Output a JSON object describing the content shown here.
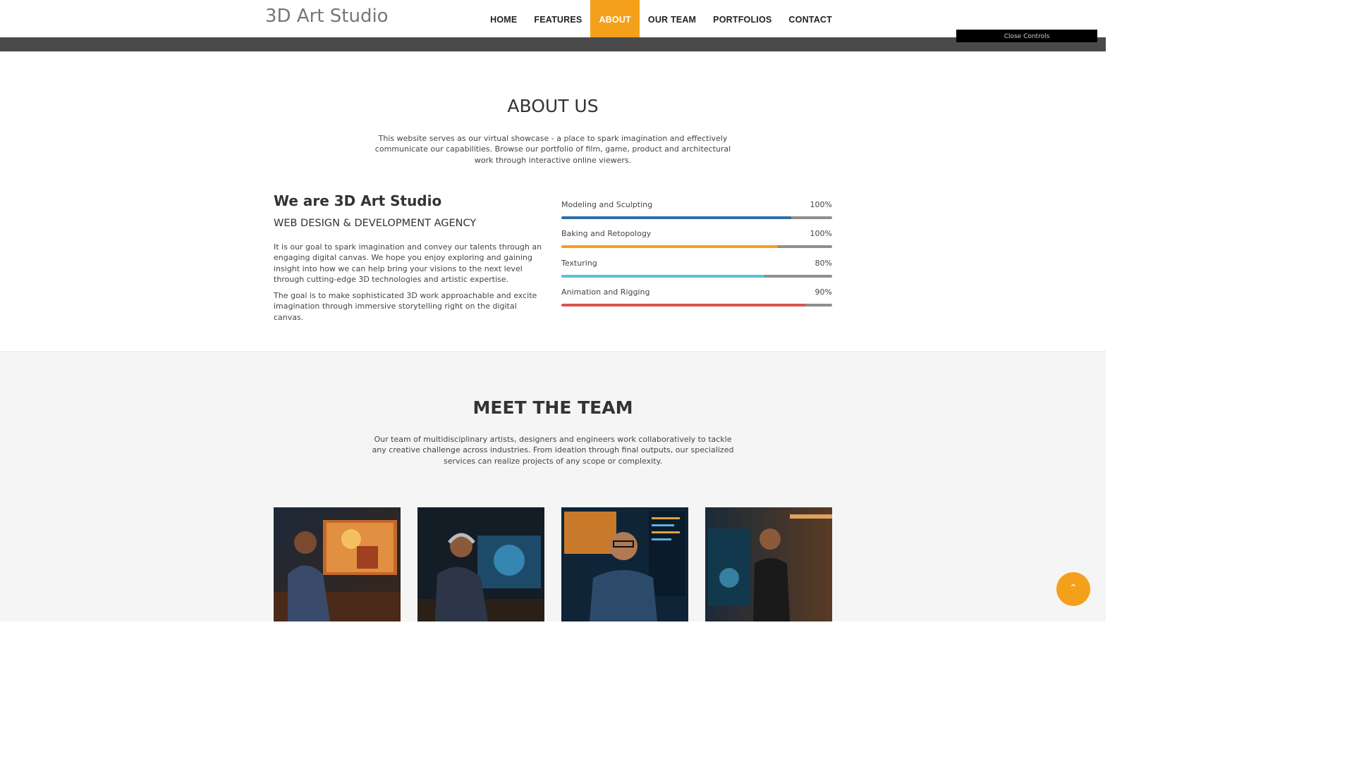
{
  "header": {
    "logo": "3D Art Studio",
    "nav": [
      "HOME",
      "FEATURES",
      "ABOUT",
      "OUR TEAM",
      "PORTFOLIOS",
      "CONTACT"
    ],
    "active_nav": "ABOUT",
    "close_controls_label": "Close Controls"
  },
  "about": {
    "title": "ABOUT US",
    "intro": "This website serves as our virtual showcase - a place to spark imagination and effectively communicate our capabilities. Browse our portfolio of film, game, product and architectural work through interactive online viewers.",
    "heading": "We are 3D Art Studio",
    "subheading": "WEB DESIGN & DEVELOPMENT AGENCY",
    "paragraph1": "It is our goal to spark imagination and convey our talents through an engaging digital canvas. We hope you enjoy exploring and gaining insight into how we can help bring your visions to the next level through cutting-edge 3D technologies and artistic expertise.",
    "paragraph2": "The goal is to make sophisticated 3D work approachable and excite imagination through immersive storytelling right on the digital canvas.",
    "skills": [
      {
        "label": "Modeling and Sculpting",
        "percent": "100%",
        "fill_fraction": 0.85,
        "color": "#2f6fa6"
      },
      {
        "label": "Baking and Retopology",
        "percent": "100%",
        "fill_fraction": 0.8,
        "color": "#f5a01a"
      },
      {
        "label": "Texturing",
        "percent": "80%",
        "fill_fraction": 0.75,
        "color": "#5bc0de"
      },
      {
        "label": "Animation and Rigging",
        "percent": "90%",
        "fill_fraction": 0.9,
        "color": "#d9534f"
      }
    ]
  },
  "team": {
    "title": "MEET THE TEAM",
    "intro": "Our team of multidisciplinary artists, designers and engineers work collaboratively to tackle any creative challenge across industries. From ideation through final outputs, our specialized services can realize projects of any scope or complexity.",
    "members": [
      {
        "photo": "artist-at-monitor-photo"
      },
      {
        "photo": "artist-with-headphones-photo"
      },
      {
        "photo": "artist-with-glasses-photo"
      },
      {
        "photo": "artist-standing-photo"
      }
    ]
  },
  "scroll_top_icon": "chevron-up-icon",
  "accent_color": "#f5a01a"
}
